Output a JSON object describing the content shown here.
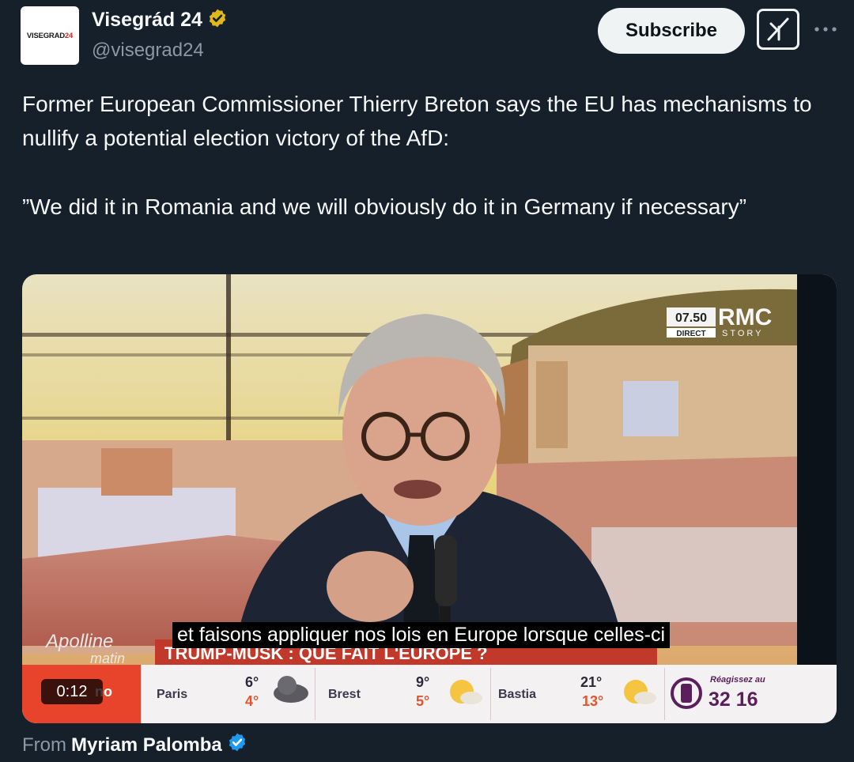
{
  "header": {
    "avatar_text_prefix": "VISEGRAD",
    "avatar_text_suffix": "24",
    "display_name": "Visegrád 24",
    "handle": "@visegrad24",
    "verified_color": "#e2b719",
    "subscribe_label": "Subscribe",
    "grok_icon": "grok-icon",
    "more_icon": "more-horizontal-icon"
  },
  "tweet": {
    "paragraph_1": "Former European Commissioner Thierry Breton says the EU has mechanisms to nullify a potential election victory of the AfD:",
    "paragraph_2": "”We did it in Romania and we will obviously do it in Germany if necessary”"
  },
  "video": {
    "channel_time": "07.50",
    "channel_name": "RMC",
    "channel_sub_1": "DIRECT",
    "channel_sub_2": "STORY",
    "show_name_1": "Apolline",
    "show_name_2": "matin",
    "banner_text": "TRUMP-MUSK : QUE FAIT L'EUROPE ?",
    "subtitle": "et faisons appliquer nos lois en Europe lorsque celles-ci",
    "duration": "0:12",
    "weather": [
      {
        "city": "Paris",
        "high": "6°",
        "low": "4°",
        "icon": "cloud-icon"
      },
      {
        "city": "Brest",
        "high": "9°",
        "low": "5°",
        "icon": "sun-cloud-icon"
      },
      {
        "city": "Bastia",
        "high": "21°",
        "low": "13°",
        "icon": "sun-cloud-icon"
      }
    ],
    "react_label": "Réagissez au",
    "react_number": "32 16",
    "partial_label": "no"
  },
  "source": {
    "from_label": "From",
    "from_name": "Myriam Palomba",
    "verified_color": "#1d9bf0"
  }
}
